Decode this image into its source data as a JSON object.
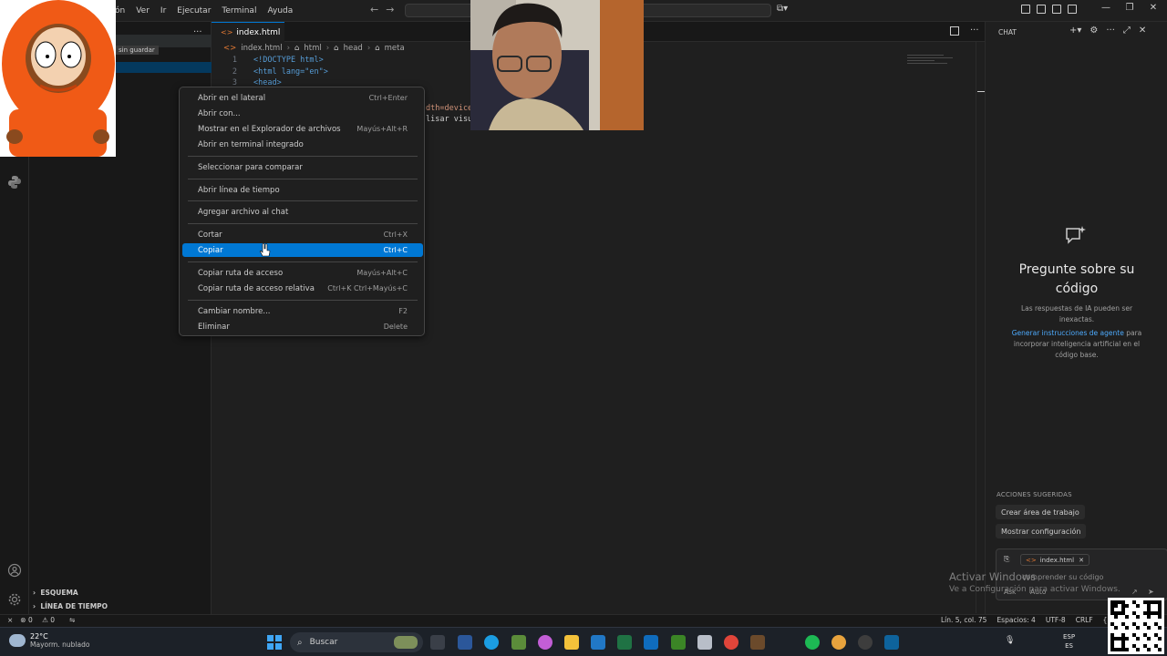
{
  "menubar": {
    "items": [
      "ón",
      "Ver",
      "Ir",
      "Ejecutar",
      "Terminal",
      "Ayuda"
    ]
  },
  "sidebar": {
    "unsaved_label": "sin guardar",
    "section_outline": "ESQUEMA",
    "section_timeline": "LÍNEA DE TIEMPO"
  },
  "editor": {
    "tab_name": "index.html",
    "breadcrumb": [
      "index.html",
      "html",
      "head",
      "meta"
    ],
    "lines": [
      {
        "num": "1",
        "text": "<!DOCTYPE html>"
      },
      {
        "num": "2",
        "text": "<html lang=\"en\">"
      },
      {
        "num": "3",
        "text": "<head>"
      }
    ],
    "visible_fragment_1": "dth=device",
    "visible_fragment_2": "lisar visu"
  },
  "context_menu": {
    "items": [
      {
        "label": "Abrir en el lateral",
        "shortcut": "Ctrl+Enter"
      },
      {
        "label": "Abrir con...",
        "shortcut": ""
      },
      {
        "label": "Mostrar en el Explorador de archivos",
        "shortcut": "Mayús+Alt+R"
      },
      {
        "label": "Abrir en terminal integrado",
        "shortcut": ""
      },
      {
        "label": "Seleccionar para comparar",
        "shortcut": ""
      },
      {
        "label": "Abrir línea de tiempo",
        "shortcut": ""
      },
      {
        "label": "Agregar archivo al chat",
        "shortcut": ""
      },
      {
        "label": "Cortar",
        "shortcut": "Ctrl+X"
      },
      {
        "label": "Copiar",
        "shortcut": "Ctrl+C"
      },
      {
        "label": "Copiar ruta de acceso",
        "shortcut": "Mayús+Alt+C"
      },
      {
        "label": "Copiar ruta de acceso relativa",
        "shortcut": "Ctrl+K Ctrl+Mayús+C"
      },
      {
        "label": "Cambiar nombre...",
        "shortcut": "F2"
      },
      {
        "label": "Eliminar",
        "shortcut": "Delete"
      }
    ],
    "active_index": 8
  },
  "chat": {
    "title": "CHAT",
    "heading": "Pregunte sobre su código",
    "subtitle": "Las respuestas de IA pueden ser inexactas.",
    "link_text": "Generar instrucciones de agente",
    "link_suffix": " para incorporar inteligencia artificial en el código base.",
    "suggested_label": "ACCIONES SUGERIDAS",
    "suggestions": [
      "Crear área de trabajo",
      "Mostrar configuración"
    ],
    "attachment": "index.html",
    "placeholder": "comprender su código",
    "mode": "Ask",
    "model": "Auto"
  },
  "watermark": {
    "line1": "Activar Windows",
    "line2": "Ve a Configuración para activar Windows."
  },
  "statusbar": {
    "errors": "0",
    "warnings": "0",
    "position": "Lín. 5, col. 75",
    "spaces": "Espacios: 4",
    "encoding": "UTF-8",
    "eol": "CRLF",
    "language": "{ }"
  },
  "taskbar": {
    "temp": "22°C",
    "weather": "Mayorm. nublado",
    "search_placeholder": "Buscar",
    "lang_top": "ESP",
    "lang_bottom": "ES"
  },
  "colors": {
    "accent": "#0078d4",
    "link": "#4daafc",
    "html_icon": "#e37933"
  }
}
